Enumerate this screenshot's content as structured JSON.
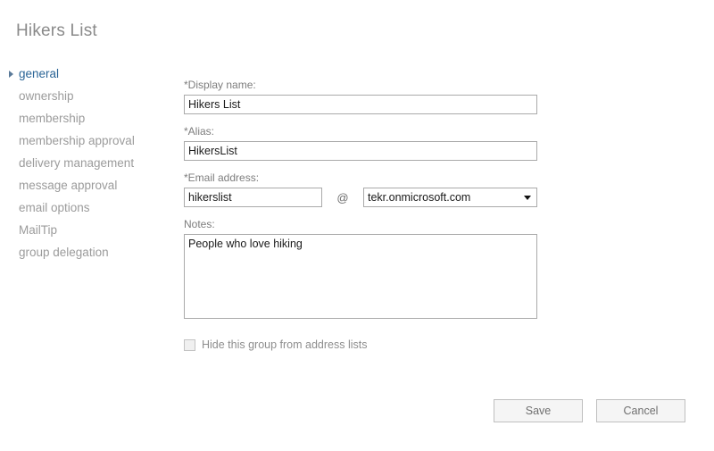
{
  "dialog": {
    "title": "Hikers List"
  },
  "nav": {
    "items": [
      {
        "label": "general",
        "selected": true,
        "marker": "triangle-right-icon"
      },
      {
        "label": "ownership",
        "selected": false
      },
      {
        "label": "membership",
        "selected": false
      },
      {
        "label": "membership approval",
        "selected": false
      },
      {
        "label": "delivery management",
        "selected": false
      },
      {
        "label": "message approval",
        "selected": false
      },
      {
        "label": "email options",
        "selected": false
      },
      {
        "label": "MailTip",
        "selected": false
      },
      {
        "label": "group delegation",
        "selected": false
      }
    ]
  },
  "form": {
    "display_name": {
      "label": "*Display name:",
      "value": "Hikers List",
      "placeholder": ""
    },
    "alias": {
      "label": "*Alias:",
      "value": "HikersList",
      "placeholder": ""
    },
    "email_address": {
      "label": "*Email address:",
      "local_value": "hikerslist",
      "local_placeholder": "",
      "at_symbol": "@",
      "domain_value": "tekr.onmicrosoft.com",
      "domain_options": [
        "tekr.onmicrosoft.com"
      ],
      "dropdown_icon": "chevron-down-icon"
    },
    "notes": {
      "label": "Notes:",
      "value": "People who love hiking",
      "placeholder": ""
    },
    "hide_group": {
      "label": "Hide this group from address lists",
      "checked": false
    }
  },
  "footer": {
    "save_label": "Save",
    "cancel_label": "Cancel"
  },
  "colors": {
    "accent": "#2a6496",
    "muted_text": "#9b9b9b",
    "label_text": "#7d7d7d",
    "border": "#aaaaaa",
    "button_face": "#f5f5f5"
  }
}
